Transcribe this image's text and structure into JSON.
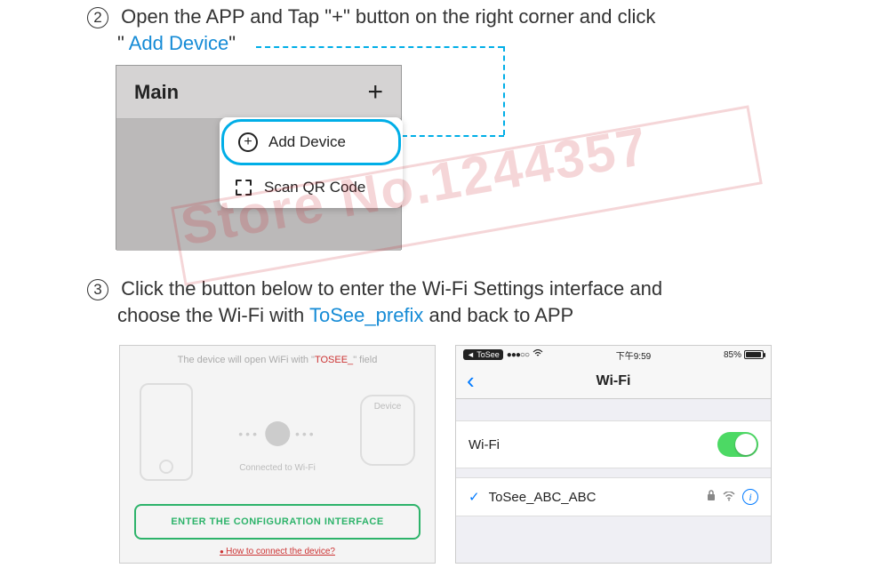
{
  "watermark": "Store No.1244357",
  "step2": {
    "marker": "2",
    "text_a": "Open the APP and Tap \"",
    "plus": "+",
    "text_b": "\" button on the right corner and click",
    "line2_a": "\" ",
    "highlight": "Add Device",
    "line2_b": "\""
  },
  "shot1": {
    "title": "Main",
    "plus": "+",
    "item1": "Add Device",
    "item2": "Scan QR Code"
  },
  "step3": {
    "marker": "3",
    "text_a": "Click the button below to enter the Wi-Fi Settings interface and",
    "line2_a": "choose the Wi-Fi with ",
    "highlight": "ToSee_prefix",
    "line2_b": " and back to APP"
  },
  "shot2": {
    "caption_a": "The device will open WiFi with \"",
    "caption_red": "TOSEE_",
    "caption_b": "\" field",
    "device": "Device",
    "connected": "Connected to Wi-Fi",
    "button": "ENTER THE CONFIGURATION INTERFACE",
    "help": "How to connect the device?"
  },
  "shot3": {
    "status_back": "ToSee",
    "status_time": "下午9:59",
    "status_batt": "85%",
    "nav_title": "Wi-Fi",
    "row1_label": "Wi-Fi",
    "row2_label": "ToSee_ABC_ABC"
  }
}
